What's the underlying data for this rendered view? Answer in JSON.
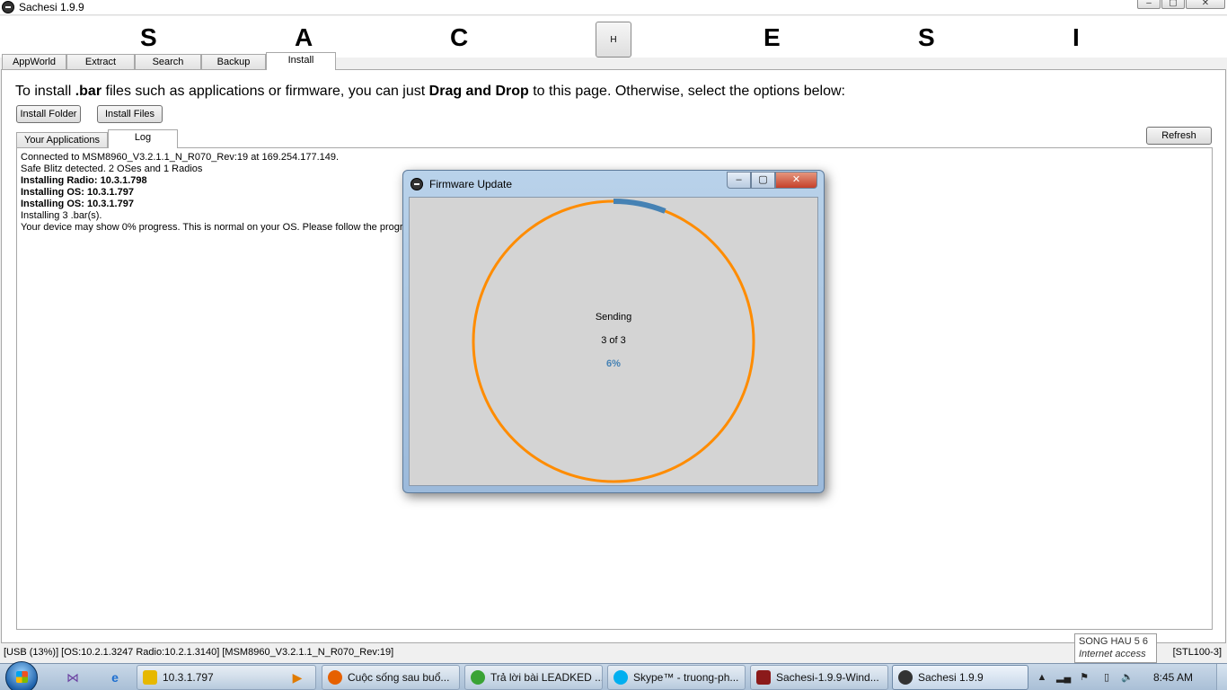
{
  "window": {
    "title": "Sachesi 1.9.9",
    "controls": [
      "–",
      "▢",
      "✕"
    ]
  },
  "banner": {
    "letters": [
      "S",
      "A",
      "C",
      "H",
      "E",
      "S",
      "I"
    ],
    "h_button": "H"
  },
  "main_tabs": [
    "AppWorld",
    "Extract",
    "Search",
    "Backup",
    "Install"
  ],
  "install": {
    "instructions": {
      "pre": "To install ",
      "bar": ".bar",
      "mid": " files such as applications or firmware, you can just ",
      "dnd": "Drag and Drop",
      "post": " to this page. Otherwise, select the options below:"
    },
    "install_folder": "Install Folder",
    "install_files": "Install Files",
    "refresh": "Refresh",
    "sub_tabs": [
      "Your Applications",
      "Log"
    ],
    "log": [
      "Connected to MSM8960_V3.2.1.1_N_R070_Rev:19 at 169.254.177.149.",
      "Safe Blitz detected. 2 OSes and 1 Radios",
      "Installing Radio: 10.3.1.798",
      "Installing OS: 10.3.1.797",
      "Installing OS: 10.3.1.797",
      "Installing 3 .bar(s).",
      "Your device may show 0% progress. This is normal on your OS. Please follow the progres"
    ]
  },
  "status": {
    "left": "[USB (13%)] [OS:10.2.1.3247 Radio:10.2.1.3140] [MSM8960_V3.2.1.1_N_R070_Rev:19]",
    "right": "[STL100-3]"
  },
  "dialog": {
    "title": "Firmware Update",
    "status": "Sending",
    "count": "3 of 3",
    "percent_label": "6%",
    "progress_fraction": 0.06,
    "ring_color": "#ff8c00",
    "progress_color": "#4682b4"
  },
  "taskbar": {
    "buttons": [
      {
        "label": "10.3.1.797",
        "color": "#e6b800"
      },
      {
        "label": "Cuộc sống sau buổ...",
        "color": "#e66000"
      },
      {
        "label": "Trả lời bài LEADKED ...",
        "color": "#3aa335"
      },
      {
        "label": "Skype™ - truong-ph...",
        "color": "#00aff0"
      },
      {
        "label": "Sachesi-1.9.9-Wind...",
        "color": "#8b1a1a"
      },
      {
        "label": "Sachesi 1.9.9",
        "color": "#333333"
      }
    ],
    "clock": "8:45 AM"
  },
  "tooltip": {
    "line1": "SONG HAU 5  6",
    "line2": "Internet access"
  }
}
